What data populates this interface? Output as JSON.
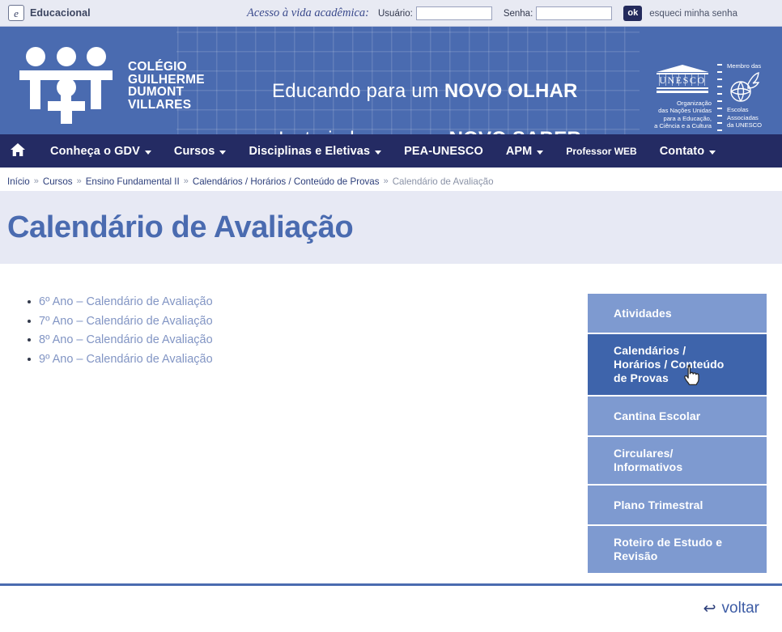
{
  "topbar": {
    "brand_label": "Educacional",
    "brand_icon": "pen-square-icon",
    "acesso_text": "Acesso à vida acadêmica:",
    "user_label": "Usuário:",
    "user_value": "",
    "user_placeholder": "",
    "password_label": "Senha:",
    "password_value": "",
    "password_placeholder": "",
    "ok_label": "ok",
    "forgot_label": "esqueci minha senha"
  },
  "banner": {
    "school_name_line1": "COLÉGIO",
    "school_name_line2": "GUILHERME",
    "school_name_line3": "DUMONT",
    "school_name_line4": "VILLARES",
    "slogan1_plain": "Educando para um ",
    "slogan1_bold": "NOVO OLHAR",
    "slogan2_plain": "Instruindo para um ",
    "slogan2_bold": "NOVO SABER",
    "unesco_word": "UNESCO",
    "unesco_caption": "Organização\ndas Nações Unidas\npara a Educação,\na Ciência e a Cultura",
    "membro_text": "Membro das",
    "escolas_text": "Escolas\nAssociadas\nda UNESCO"
  },
  "nav": {
    "home_icon": "home-icon",
    "items": [
      {
        "label": "Conheça o GDV",
        "has_caret": true
      },
      {
        "label": "Cursos",
        "has_caret": true
      },
      {
        "label": "Disciplinas e Eletivas",
        "has_caret": true
      },
      {
        "label": "PEA-UNESCO",
        "has_caret": false
      },
      {
        "label": "APM",
        "has_caret": true
      },
      {
        "label": "Professor WEB",
        "has_caret": false
      },
      {
        "label": "Contato",
        "has_caret": true
      }
    ]
  },
  "breadcrumb": {
    "separator": "»",
    "items": [
      {
        "label": "Início",
        "current": false
      },
      {
        "label": "Cursos",
        "current": false
      },
      {
        "label": "Ensino Fundamental II",
        "current": false
      },
      {
        "label": "Calendários / Horários / Conteúdo de Provas",
        "current": false
      },
      {
        "label": "Calendário de Avaliação",
        "current": true
      }
    ]
  },
  "page": {
    "title": "Calendário de Avaliação"
  },
  "main": {
    "links": [
      "6º Ano – Calendário de Avaliação",
      "7º Ano – Calendário de Avaliação",
      "8º Ano – Calendário de Avaliação",
      "9º Ano – Calendário de Avaliação"
    ]
  },
  "sidebar": {
    "items": [
      {
        "label": "Atividades",
        "active": false
      },
      {
        "label": "Calendários /\nHorários / Conteúdo\nde Provas",
        "active": true
      },
      {
        "label": "Cantina Escolar",
        "active": false
      },
      {
        "label": "Circulares/\nInformativos",
        "active": false
      },
      {
        "label": "Plano Trimestral",
        "active": false
      },
      {
        "label": "Roteiro de Estudo e\nRevisão",
        "active": false
      }
    ]
  },
  "footer": {
    "back_label": "voltar",
    "back_icon": "arrow-back-icon"
  },
  "colors": {
    "topbar_bg": "#e8eaf3",
    "banner_blue": "#4a6bb0",
    "nav_navy": "#242b63",
    "title_band": "#e7e9f4",
    "title_text": "#4a6bb0",
    "sidebar_item": "#7e9ad0",
    "sidebar_active": "#3e64ab",
    "link_blue": "#8295c4",
    "breadcrumb_link": "#2c3e7a"
  }
}
